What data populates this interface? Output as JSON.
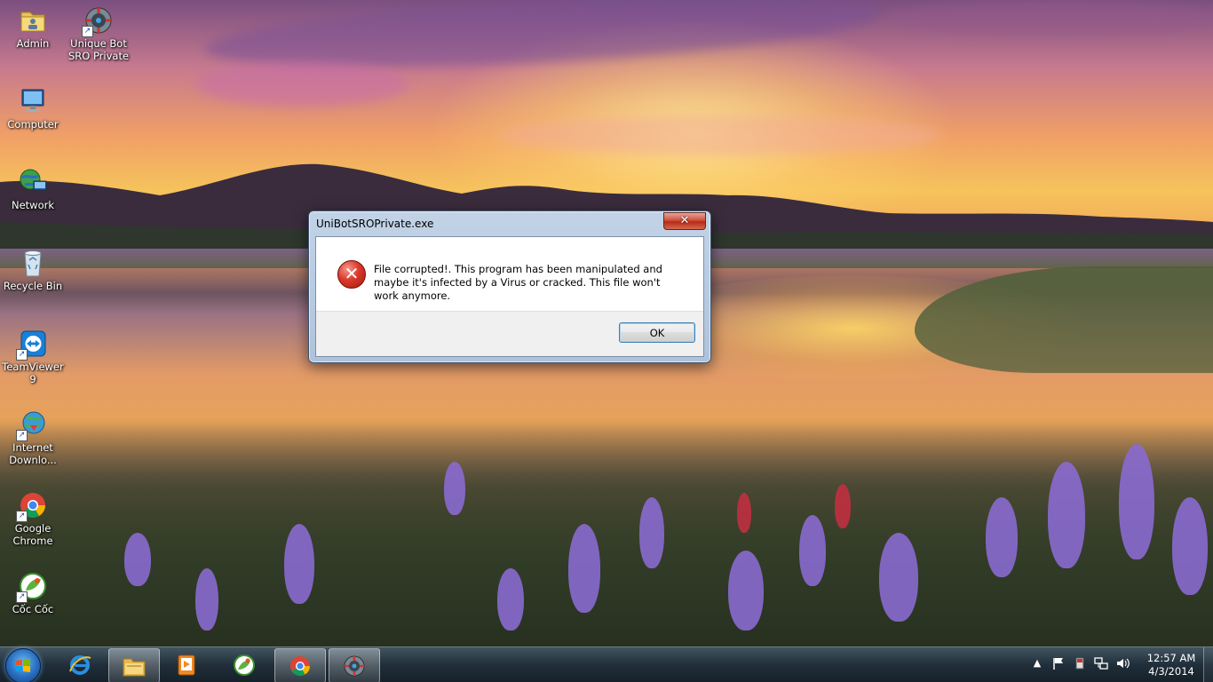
{
  "desktop": {
    "icons": [
      {
        "label": "Admin",
        "icon": "user-folder-icon"
      },
      {
        "label": "Unique Bot SRO Private",
        "icon": "bot-app-icon"
      },
      {
        "label": "Computer",
        "icon": "computer-icon"
      },
      {
        "label": "Network",
        "icon": "network-globe-icon"
      },
      {
        "label": "Recycle Bin",
        "icon": "recycle-bin-icon"
      },
      {
        "label": "TeamViewer 9",
        "icon": "teamviewer-icon"
      },
      {
        "label": "Internet Downlo...",
        "icon": "internet-download-manager-icon"
      },
      {
        "label": "Google Chrome",
        "icon": "chrome-icon"
      },
      {
        "label": "Cốc Cốc",
        "icon": "coccoc-browser-icon"
      }
    ]
  },
  "dialog": {
    "title": "UniBotSROPrivate.exe",
    "close_label": "✕",
    "message": "File corrupted!. This program has been manipulated and maybe it's infected by a Virus or cracked. This file won't work anymore.",
    "ok_label": "OK",
    "icon": "error-icon"
  },
  "taskbar": {
    "pinned": [
      {
        "icon": "internet-explorer-icon",
        "active": false
      },
      {
        "icon": "windows-explorer-icon",
        "active": true
      },
      {
        "icon": "media-player-icon",
        "active": false
      },
      {
        "icon": "coccoc-browser-icon",
        "active": false
      },
      {
        "icon": "chrome-icon",
        "active": true
      },
      {
        "icon": "bot-app-icon",
        "active": true
      }
    ],
    "tray_icons": [
      "show-hidden-icons-icon",
      "action-center-flag-icon",
      "usb-device-icon",
      "network-icon",
      "volume-icon"
    ],
    "clock_time": "12:57 AM",
    "clock_date": "4/3/2014"
  }
}
